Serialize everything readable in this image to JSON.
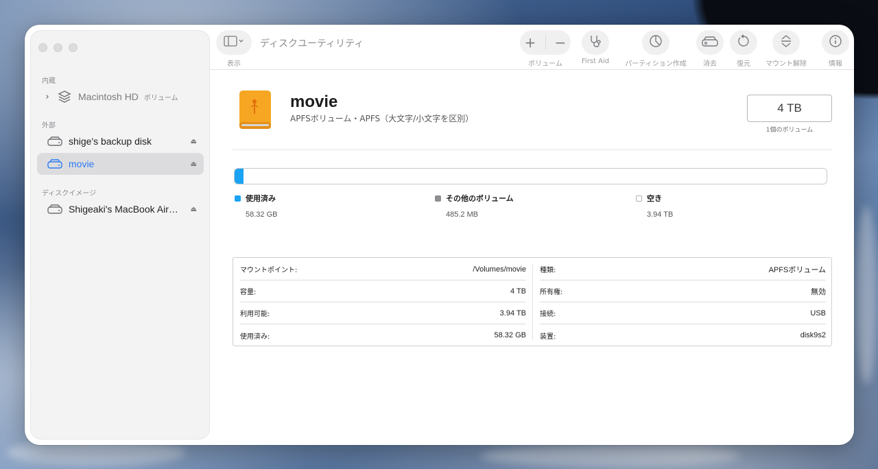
{
  "sidebar": {
    "sections": {
      "internal": "内蔵",
      "external": "外部",
      "disk_images": "ディスクイメージ"
    },
    "items": [
      {
        "label": "Macintosh HD",
        "sublabel": "ボリューム"
      },
      {
        "label": "shige's backup disk"
      },
      {
        "label": "movie"
      },
      {
        "label": "Shigeaki's MacBook Air…"
      }
    ]
  },
  "toolbar": {
    "title": "ディスクユーティリティ",
    "view_label": "表示",
    "volume_label": "ボリューム",
    "first_aid_label": "First Aid",
    "partition_label": "パーティション作成",
    "erase_label": "消去",
    "restore_label": "復元",
    "unmount_label": "マウント解除",
    "info_label": "情報"
  },
  "volume": {
    "name": "movie",
    "description": "APFSボリューム・APFS（大文字/小文字を区別）",
    "capacity": "4 TB",
    "capacity_sub": "1個のボリューム",
    "used_fraction": 0.0146
  },
  "legend": [
    {
      "label": "使用済み",
      "value": "58.32 GB",
      "color": "#1aa3f4"
    },
    {
      "label": "その他のボリューム",
      "value": "485.2 MB",
      "color": "#8e8e93"
    },
    {
      "label": "空き",
      "value": "3.94 TB",
      "color": "#ffffff"
    }
  ],
  "info": {
    "left": [
      {
        "key": "マウントポイント:",
        "value": "/Volumes/movie"
      },
      {
        "key": "容量:",
        "value": "4 TB"
      },
      {
        "key": "利用可能:",
        "value": "3.94 TB"
      },
      {
        "key": "使用済み:",
        "value": "58.32 GB"
      }
    ],
    "right": [
      {
        "key": "種類:",
        "value": "APFSボリューム"
      },
      {
        "key": "所有権:",
        "value": "無効"
      },
      {
        "key": "接続:",
        "value": "USB"
      },
      {
        "key": "装置:",
        "value": "disk9s2"
      }
    ]
  }
}
